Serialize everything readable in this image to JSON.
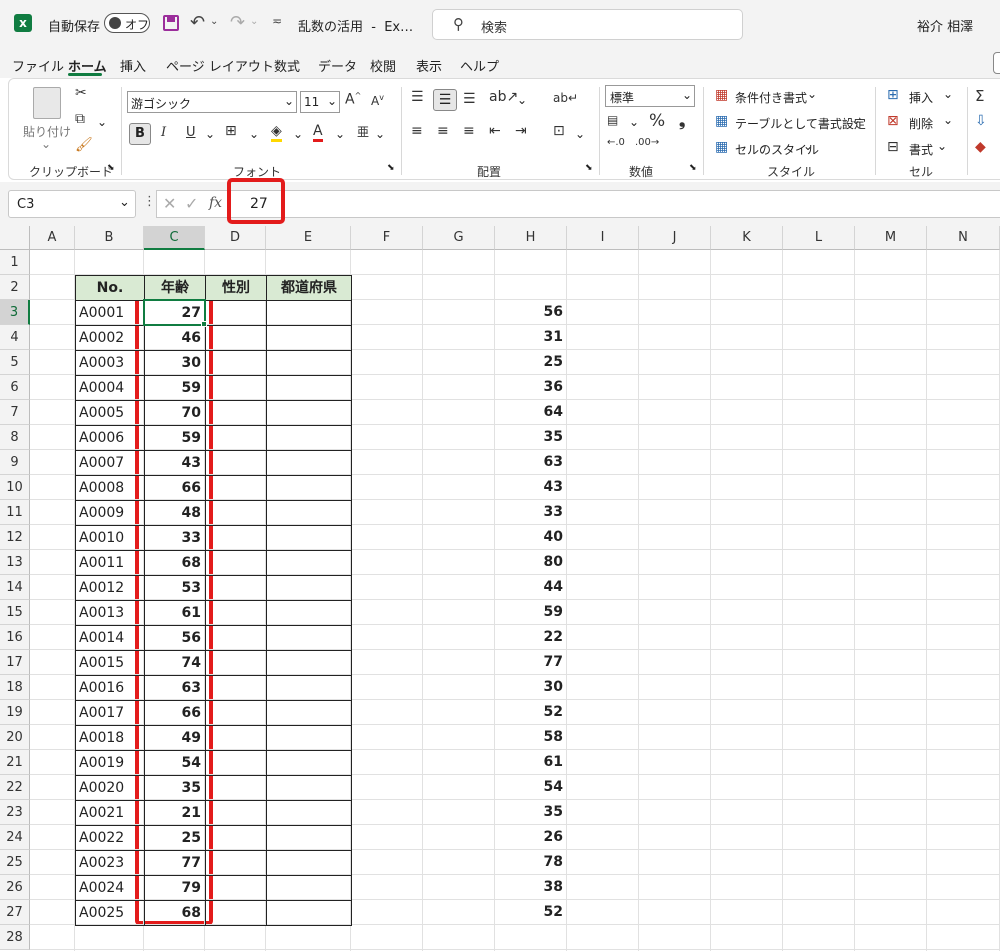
{
  "titlebar": {
    "autosave_label": "自動保存",
    "autosave_state": "オフ",
    "doc_title": "乱数の活用  -  Ex…",
    "search_placeholder": "検索",
    "user_name": "裕介 相澤"
  },
  "tabs": [
    "ファイル",
    "ホーム",
    "挿入",
    "ページ レイアウト",
    "数式",
    "データ",
    "校閲",
    "表示",
    "ヘルプ"
  ],
  "ribbon": {
    "clipboard": {
      "paste_label": "貼り付け",
      "group_label": "クリップボード"
    },
    "font": {
      "font_name": "游ゴシック",
      "font_size": "11",
      "bold": "B",
      "italic": "I",
      "underline": "U",
      "group_label": "フォント"
    },
    "alignment": {
      "group_label": "配置"
    },
    "number": {
      "format": "標準",
      "percent": "%",
      "comma": "❟",
      "group_label": "数値"
    },
    "styles": {
      "conditional": "条件付き書式",
      "table": "テーブルとして書式設定",
      "cell_style": "セルのスタイル",
      "group_label": "スタイル"
    },
    "cells": {
      "insert": "挿入",
      "delete": "削除",
      "format": "書式",
      "group_label": "セル"
    },
    "editing": {
      "sum": "Σ"
    }
  },
  "formula_bar": {
    "name_box": "C3",
    "fx": "fx",
    "value": "27"
  },
  "columns": [
    "A",
    "B",
    "C",
    "D",
    "E",
    "F",
    "G",
    "H",
    "I",
    "J",
    "K",
    "L",
    "M",
    "N"
  ],
  "rows": [
    "1",
    "2",
    "3",
    "4",
    "5",
    "6",
    "7",
    "8",
    "9",
    "10",
    "11",
    "12",
    "13",
    "14",
    "15",
    "16",
    "17",
    "18",
    "19",
    "20",
    "21",
    "22",
    "23",
    "24",
    "25",
    "26",
    "27",
    "28"
  ],
  "table": {
    "headers": [
      "No.",
      "年齢",
      "性別",
      "都道府県"
    ],
    "ids": [
      "A0001",
      "A0002",
      "A0003",
      "A0004",
      "A0005",
      "A0006",
      "A0007",
      "A0008",
      "A0009",
      "A0010",
      "A0011",
      "A0012",
      "A0013",
      "A0014",
      "A0015",
      "A0016",
      "A0017",
      "A0018",
      "A0019",
      "A0020",
      "A0021",
      "A0022",
      "A0023",
      "A0024",
      "A0025"
    ],
    "ages": [
      "27",
      "46",
      "30",
      "59",
      "70",
      "59",
      "43",
      "66",
      "48",
      "33",
      "68",
      "53",
      "61",
      "56",
      "74",
      "63",
      "66",
      "49",
      "54",
      "35",
      "21",
      "25",
      "77",
      "79",
      "68"
    ]
  },
  "column_h": [
    "56",
    "31",
    "25",
    "36",
    "64",
    "35",
    "63",
    "43",
    "33",
    "40",
    "80",
    "44",
    "59",
    "22",
    "77",
    "30",
    "52",
    "58",
    "61",
    "54",
    "35",
    "26",
    "78",
    "38",
    "52"
  ],
  "colors": {
    "accent_red": "#e31b1b",
    "header_fill": "#d9ead3",
    "excel_green": "#107c41",
    "save_purple": "#9b2d9b"
  }
}
